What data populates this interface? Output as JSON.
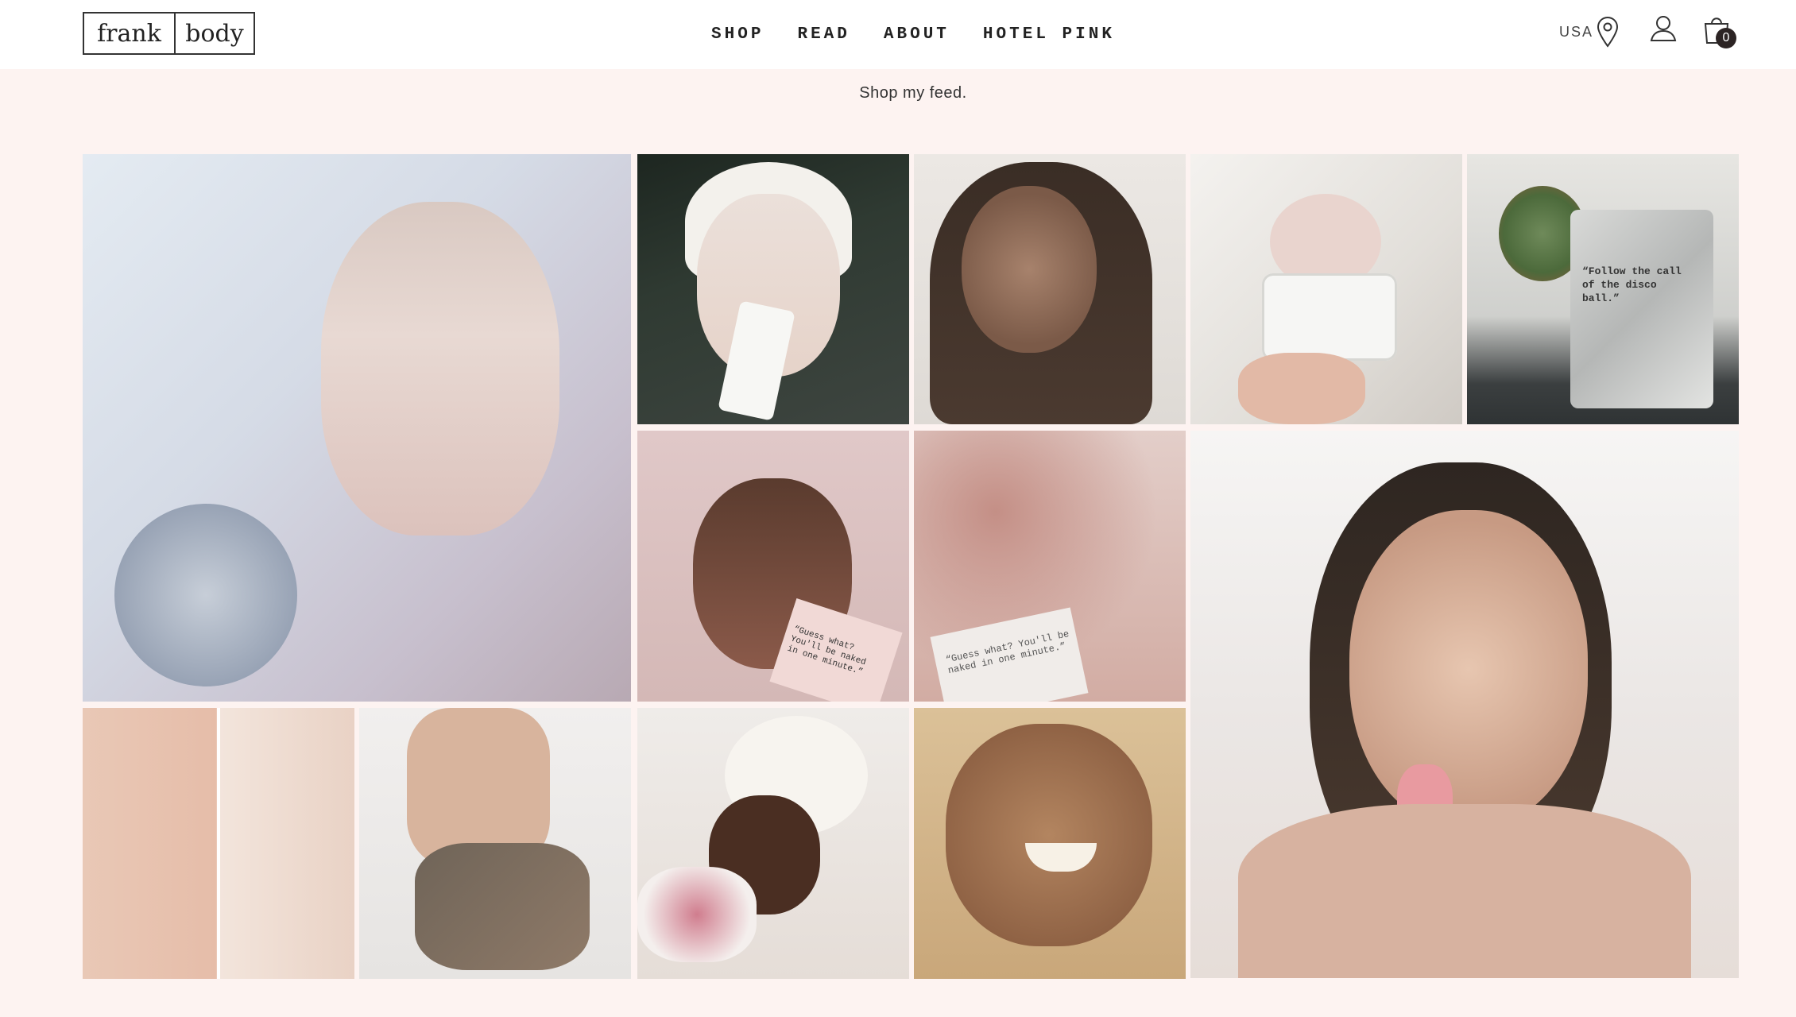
{
  "brand": {
    "logo_left": "frank",
    "logo_right": "body"
  },
  "nav": {
    "items": [
      "SHOP",
      "READ",
      "ABOUT",
      "HOTEL PINK"
    ]
  },
  "header": {
    "region": "USA",
    "cart_count": "0"
  },
  "feed": {
    "title": "Shop my feed.",
    "posts": [
      {
        "caption": "Woman with slicked hair touching lip beside mirror",
        "palette": [
          "#dfe6ee",
          "#c9c4d3",
          "#b9a9b4"
        ]
      },
      {
        "caption": "Woman in towel holding white tube, face mask",
        "palette": [
          "#1e2721",
          "#e9dfd8",
          "#f5f3ef"
        ]
      },
      {
        "caption": "Woman with coffee scrub on face",
        "palette": [
          "#e8e3de",
          "#7b5a48",
          "#d7b9a6"
        ]
      },
      {
        "caption": "Hand holding open frank body jar",
        "palette": [
          "#ebe8e3",
          "#d8d6d2",
          "#b98a79"
        ]
      },
      {
        "caption": "Silver pouch with plant in background",
        "palette": [
          "#c8c8c4",
          "#9aa2a1",
          "#dad9d4"
        ],
        "text": "“Follow the call of the disco ball.”"
      },
      {
        "caption": "Woman with scrub holding pink pouch",
        "palette": [
          "#d8bdbd",
          "#8b5a4a",
          "#f0ddd7"
        ],
        "text": "“Guess what? You'll be naked in one minute.”"
      },
      {
        "caption": "Scrub on chest holding white pouch",
        "palette": [
          "#d9b9b1",
          "#a87f76",
          "#efe7e3"
        ],
        "text": "“Guess what? You'll be naked in one minute.”"
      },
      {
        "caption": "Woman with scrub sticking out tongue",
        "palette": [
          "#f1efee",
          "#c79a83",
          "#4b3a2f"
        ]
      },
      {
        "caption": "Before and after skin comparison",
        "palette": [
          "#e8c4b3",
          "#d6a894",
          "#f2e2d8"
        ]
      },
      {
        "caption": "Person sitting on bed with scrub on arms",
        "palette": [
          "#eeeceb",
          "#8f7a68",
          "#c6a58f"
        ]
      },
      {
        "caption": "Woman in towel turban in bath with petals",
        "palette": [
          "#f2efec",
          "#5a3a2c",
          "#c6788a"
        ]
      },
      {
        "caption": "Smiling woman with coffee scrub",
        "palette": [
          "#dcbf93",
          "#9b6a47",
          "#efd9b5"
        ]
      }
    ]
  }
}
